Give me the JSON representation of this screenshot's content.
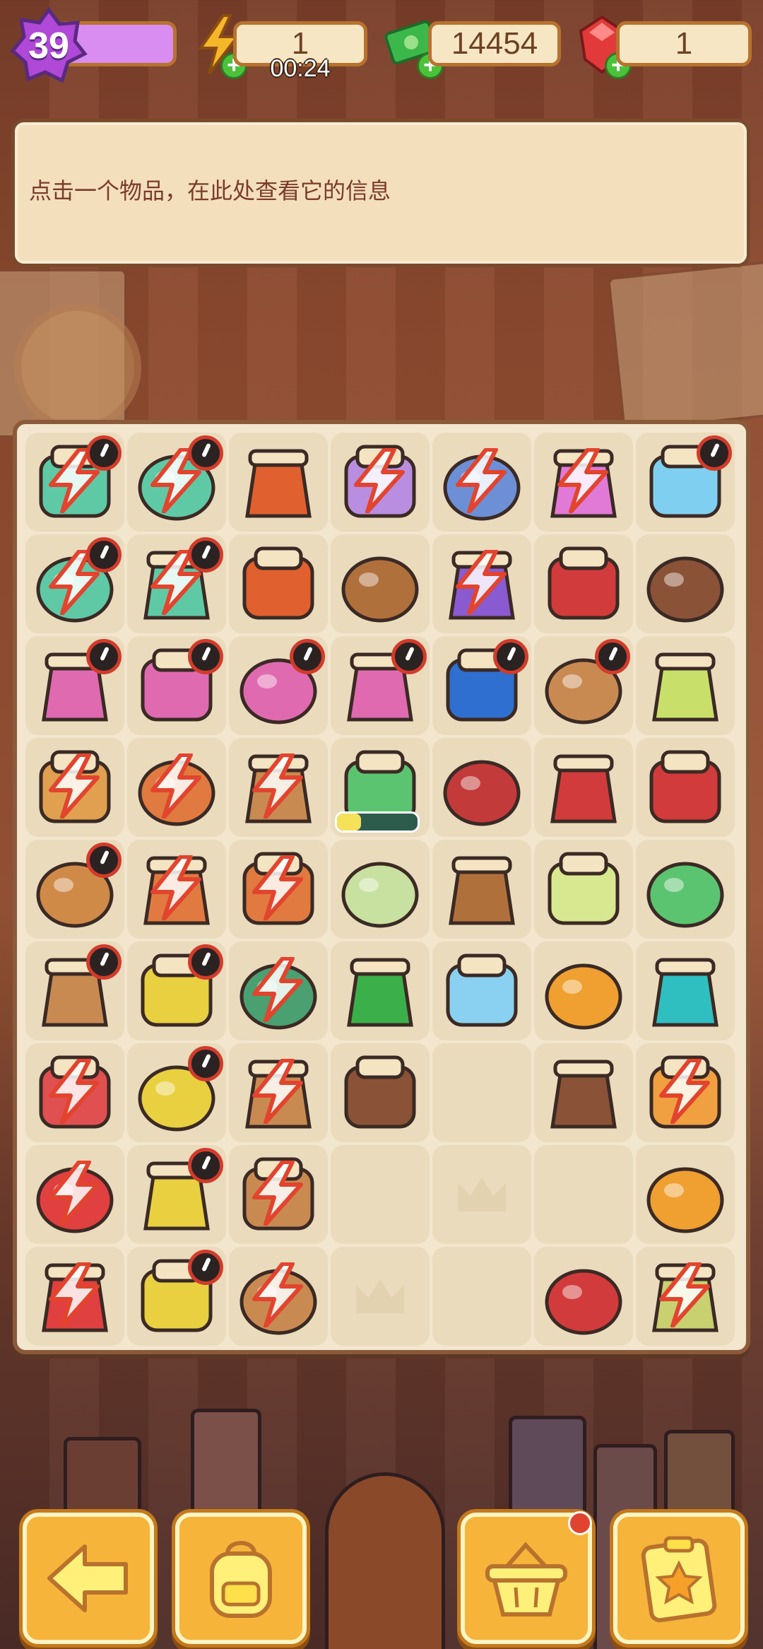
{
  "hud": {
    "level": "39",
    "energy": "1",
    "energy_timer": "00:24",
    "cash": "14454",
    "gems": "1"
  },
  "info_panel": {
    "hint": "点击一个物品，在此处查看它的信息"
  },
  "board": {
    "rows": 9,
    "cols": 7,
    "cells": [
      {
        "item": "medkit-icon",
        "color": "#5fc9a6",
        "lock": true,
        "timer": true
      },
      {
        "item": "medkit-icon",
        "color": "#5fc9a6",
        "lock": true,
        "timer": true
      },
      {
        "item": "dragon-vase-icon",
        "color": "#e0602f",
        "lock": false,
        "timer": false
      },
      {
        "item": "helicopter-icon",
        "color": "#b98ee0",
        "lock": true,
        "timer": false
      },
      {
        "item": "jeep-icon",
        "color": "#6d8fd6",
        "lock": true,
        "timer": false
      },
      {
        "item": "blossom-tree-icon",
        "color": "#e07ad6",
        "lock": true,
        "timer": false
      },
      {
        "item": "crystal-pyramid-icon",
        "color": "#7fd0f0",
        "lock": false,
        "timer": true
      },
      {
        "item": "medkit-icon",
        "color": "#5fc9a6",
        "lock": true,
        "timer": true
      },
      {
        "item": "medkit-icon",
        "color": "#5fc9a6",
        "lock": true,
        "timer": true
      },
      {
        "item": "dragon-vase-icon",
        "color": "#e0602f",
        "lock": false,
        "timer": false
      },
      {
        "item": "llama-bust-icon",
        "color": "#b0703c",
        "lock": false,
        "timer": false
      },
      {
        "item": "atv-icon",
        "color": "#8a5ad0",
        "lock": true,
        "timer": false
      },
      {
        "item": "saw-icon",
        "color": "#d23b3b",
        "lock": false,
        "timer": false
      },
      {
        "item": "envelope-icon",
        "color": "#8a5236",
        "lock": false,
        "timer": false
      },
      {
        "item": "flower-bed-icon",
        "color": "#e06ab0",
        "lock": false,
        "timer": true
      },
      {
        "item": "flower-bed-icon",
        "color": "#e06ab0",
        "lock": false,
        "timer": true
      },
      {
        "item": "flower-bed-icon",
        "color": "#e06ab0",
        "lock": false,
        "timer": true
      },
      {
        "item": "flower-bed-icon",
        "color": "#e06ab0",
        "lock": false,
        "timer": true
      },
      {
        "item": "treasure-chest-icon",
        "color": "#2f6fd0",
        "lock": false,
        "timer": true
      },
      {
        "item": "cardboard-box-icon",
        "color": "#c98a52",
        "lock": false,
        "timer": true
      },
      {
        "item": "spray-bottle-icon",
        "color": "#c8e06a",
        "lock": false,
        "timer": false
      },
      {
        "item": "crate-icon",
        "color": "#e0a050",
        "lock": true,
        "timer": false
      },
      {
        "item": "plant-pot-icon",
        "color": "#e07a40",
        "lock": true,
        "timer": false
      },
      {
        "item": "clay-pot-icon",
        "color": "#c98a52",
        "lock": true,
        "timer": false
      },
      {
        "item": "paintbrush-icon",
        "color": "#5bc470",
        "lock": false,
        "timer": false,
        "progress": 0.3
      },
      {
        "item": "duster-icon",
        "color": "#c23a3a",
        "lock": false,
        "timer": false
      },
      {
        "item": "gloves-icon",
        "color": "#d23b3b",
        "lock": false,
        "timer": false
      },
      {
        "item": "gloves-icon",
        "color": "#d23b3b",
        "lock": false,
        "timer": false
      },
      {
        "item": "wooden-crates-icon",
        "color": "#d08a48",
        "lock": false,
        "timer": true
      },
      {
        "item": "plant-pot-icon",
        "color": "#e07a40",
        "lock": true,
        "timer": false
      },
      {
        "item": "plant-pot-icon",
        "color": "#e07a40",
        "lock": true,
        "timer": false
      },
      {
        "item": "bread-icon",
        "color": "#c8e0a0",
        "lock": false,
        "timer": false
      },
      {
        "item": "cup-icon",
        "color": "#b0703c",
        "lock": false,
        "timer": false
      },
      {
        "item": "lotion-bottle-icon",
        "color": "#d8e890",
        "lock": false,
        "timer": false
      },
      {
        "item": "marker-icon",
        "color": "#5bc470",
        "lock": false,
        "timer": false
      },
      {
        "item": "pottery-shelf-icon",
        "color": "#c98a52",
        "lock": false,
        "timer": true
      },
      {
        "item": "bucket-icon",
        "color": "#e8d040",
        "lock": false,
        "timer": true
      },
      {
        "item": "dig-site-icon",
        "color": "#4aa070",
        "lock": true,
        "timer": false
      },
      {
        "item": "sponge-icon",
        "color": "#3bb04a",
        "lock": false,
        "timer": false
      },
      {
        "item": "glass-cup-icon",
        "color": "#8ad0f0",
        "lock": false,
        "timer": false
      },
      {
        "item": "key-icon",
        "color": "#f0a030",
        "lock": false,
        "timer": false
      },
      {
        "item": "walkie-talkie-icon",
        "color": "#2fbfc0",
        "lock": false,
        "timer": false
      },
      {
        "item": "tool-kit-icon",
        "color": "#e05050",
        "lock": true,
        "timer": false
      },
      {
        "item": "cart-icon",
        "color": "#e8d040",
        "lock": false,
        "timer": true
      },
      {
        "item": "tent-icon",
        "color": "#c98a52",
        "lock": true,
        "timer": false
      },
      {
        "item": "evidence-bag-icon",
        "color": "#8a5236",
        "lock": false,
        "timer": false
      },
      {
        "item": "empty",
        "color": "",
        "lock": false,
        "timer": false
      },
      {
        "item": "evidence-bag-icon",
        "color": "#8a5236",
        "lock": false,
        "timer": false
      },
      {
        "item": "parcel-icon",
        "color": "#f0a040",
        "lock": true,
        "timer": false
      },
      {
        "item": "toolbox-icon",
        "color": "#e04040",
        "lock": true,
        "timer": false
      },
      {
        "item": "cart-icon",
        "color": "#e8d040",
        "lock": false,
        "timer": true
      },
      {
        "item": "crate-stack-icon",
        "color": "#c98a52",
        "lock": true,
        "timer": false
      },
      {
        "item": "empty",
        "color": "",
        "lock": false,
        "timer": false
      },
      {
        "item": "crown-slot",
        "color": "",
        "lock": false,
        "timer": false
      },
      {
        "item": "empty",
        "color": "",
        "lock": false,
        "timer": false
      },
      {
        "item": "magnifier-icon",
        "color": "#f0a030",
        "lock": false,
        "timer": false
      },
      {
        "item": "toolbox-icon",
        "color": "#e04040",
        "lock": true,
        "timer": false
      },
      {
        "item": "cart-icon",
        "color": "#e8d040",
        "lock": false,
        "timer": true
      },
      {
        "item": "machine-icon",
        "color": "#c98a52",
        "lock": true,
        "timer": false
      },
      {
        "item": "crown-slot",
        "color": "",
        "lock": false,
        "timer": false
      },
      {
        "item": "empty",
        "color": "",
        "lock": false,
        "timer": false
      },
      {
        "item": "axe-icon",
        "color": "#d23b3b",
        "lock": false,
        "timer": false
      },
      {
        "item": "seed-bag-icon",
        "color": "#c8d070",
        "lock": true,
        "timer": false
      }
    ]
  },
  "buttons": {
    "back": "back-arrow-icon",
    "backpack": "backpack-icon",
    "basket": "basket-icon",
    "clipboard": "clipboard-star-icon"
  },
  "colors": {
    "accent": "#f6b43a",
    "panel": "#f4dfbc",
    "text": "#7a3c2b"
  }
}
